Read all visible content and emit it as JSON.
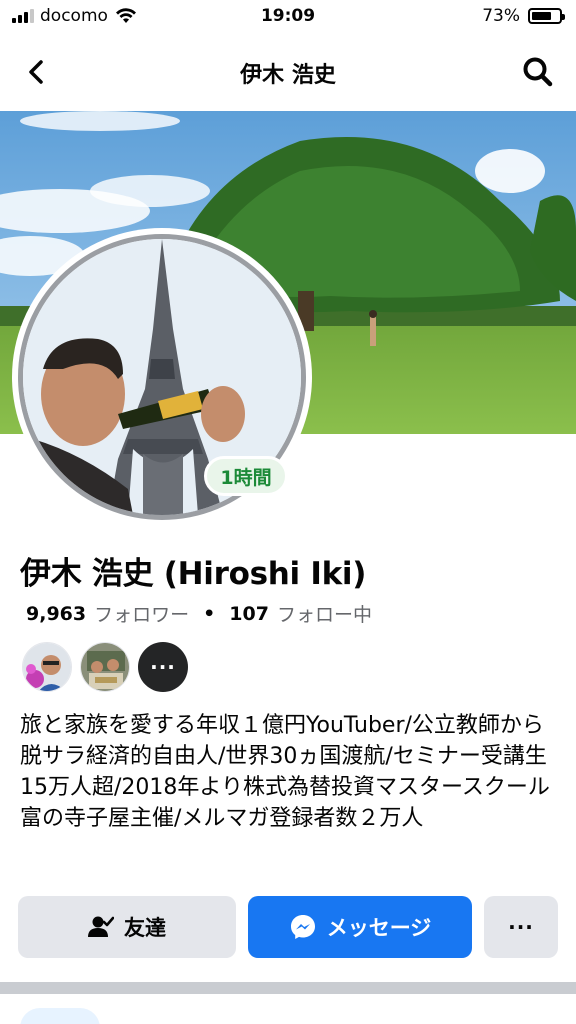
{
  "status_bar": {
    "carrier": "docomo",
    "time": "19:09",
    "battery": "73%",
    "battery_level": 0.73
  },
  "nav": {
    "title": "伊木 浩史",
    "back_icon": "chevron-left-icon",
    "search_icon": "search-icon"
  },
  "profile": {
    "story_badge": "1時間",
    "name": "伊木 浩史 (Hiroshi Iki)",
    "followers_count": "9,963",
    "followers_label": "フォロワー",
    "separator": "•",
    "following_count": "107",
    "following_label": "フォロー中",
    "more_friends": "···",
    "bio": "旅と家族を愛する年収１億円YouTuber/公立教師から脱サラ経済的自由人/世界30ヵ国渡航/セミナー受講生15万人超/2018年より株式為替投資マスタースクール富の寺子屋主催/メルマガ登録者数２万人"
  },
  "actions": {
    "friends_label": "友達",
    "message_label": "メッセージ",
    "more_label": "···"
  },
  "colors": {
    "primary": "#1877f2",
    "button_gray": "#e4e6eb",
    "story_green": "#1c8a38"
  }
}
